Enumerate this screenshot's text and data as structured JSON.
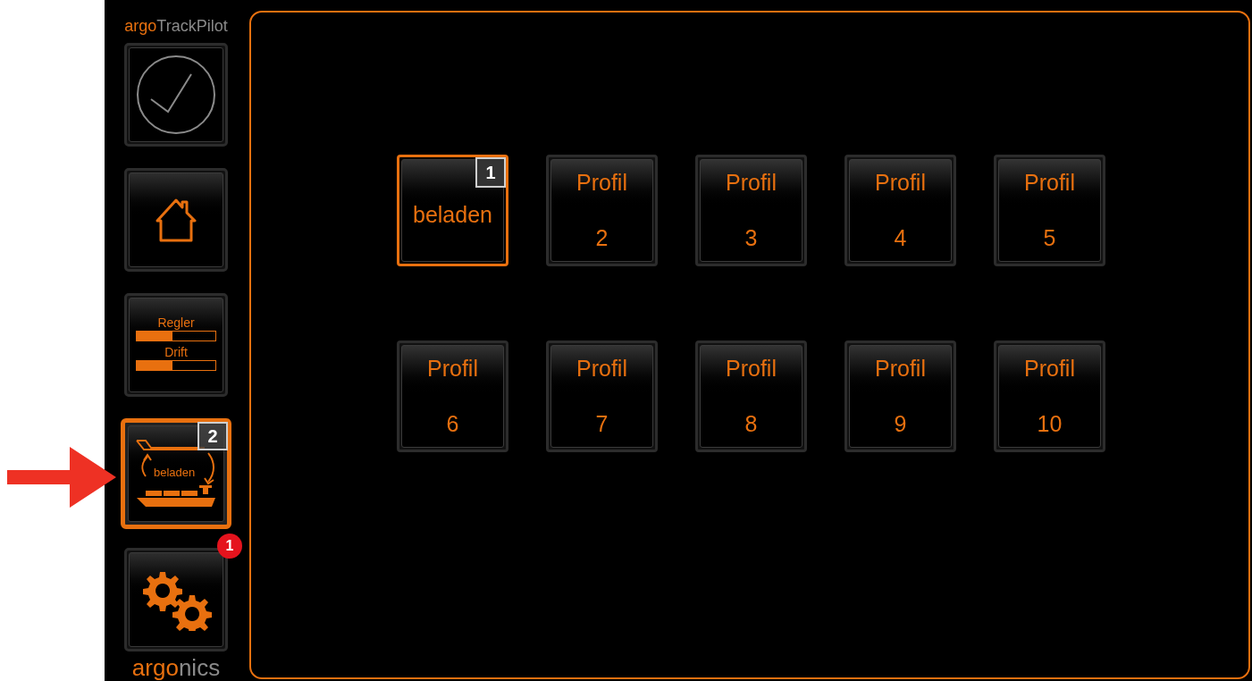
{
  "brand": {
    "prefix": "argo",
    "suffix": "TrackPilot"
  },
  "sidebar": [
    {
      "kind": "check",
      "selected": false
    },
    {
      "kind": "home",
      "selected": false
    },
    {
      "kind": "meters",
      "selected": false,
      "meters": [
        {
          "label": "Regler",
          "level": 0.45
        },
        {
          "label": "Drift",
          "level": 0.45
        }
      ]
    },
    {
      "kind": "profile",
      "selected": true,
      "label": "beladen",
      "badge": "2"
    },
    {
      "kind": "settings",
      "selected": false,
      "notification": "1"
    }
  ],
  "footer": {
    "prefix": "argo",
    "suffix": "nics"
  },
  "profiles": [
    {
      "kind": "named",
      "label": "beladen",
      "badge": "1",
      "selected": true
    },
    {
      "kind": "numbered",
      "label": "Profil",
      "number": "2",
      "selected": false
    },
    {
      "kind": "numbered",
      "label": "Profil",
      "number": "3",
      "selected": false
    },
    {
      "kind": "numbered",
      "label": "Profil",
      "number": "4",
      "selected": false
    },
    {
      "kind": "numbered",
      "label": "Profil",
      "number": "5",
      "selected": false
    },
    {
      "kind": "numbered",
      "label": "Profil",
      "number": "6",
      "selected": false
    },
    {
      "kind": "numbered",
      "label": "Profil",
      "number": "7",
      "selected": false
    },
    {
      "kind": "numbered",
      "label": "Profil",
      "number": "8",
      "selected": false
    },
    {
      "kind": "numbered",
      "label": "Profil",
      "number": "9",
      "selected": false
    },
    {
      "kind": "numbered",
      "label": "Profil",
      "number": "10",
      "selected": false
    }
  ]
}
